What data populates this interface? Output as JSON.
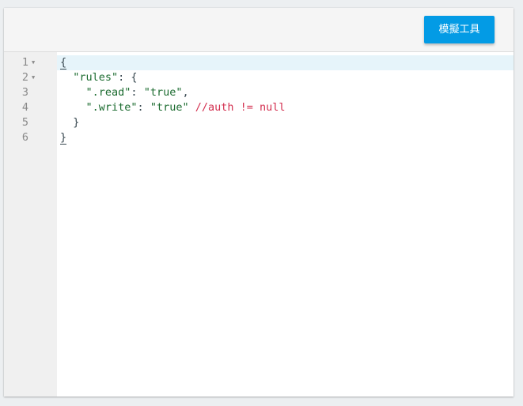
{
  "toolbar": {
    "simulator_button_label": "模擬工具"
  },
  "editor": {
    "lines": [
      {
        "number": "1",
        "foldable": true
      },
      {
        "number": "2",
        "foldable": true
      },
      {
        "number": "3",
        "foldable": false
      },
      {
        "number": "4",
        "foldable": false
      },
      {
        "number": "5",
        "foldable": false
      },
      {
        "number": "6",
        "foldable": false
      }
    ],
    "code": {
      "line1_open_brace": "{",
      "line2_indent": "  ",
      "line2_key": "\"rules\"",
      "line2_rest": ": {",
      "line3_indent": "    ",
      "line3_key": "\".read\"",
      "line3_colon": ": ",
      "line3_value": "\"true\"",
      "line3_comma": ",",
      "line4_indent": "    ",
      "line4_key": "\".write\"",
      "line4_colon": ": ",
      "line4_value": "\"true\"",
      "line4_space": " ",
      "line4_comment": "//auth != null",
      "line5_text": "  }",
      "line6_close_brace": "}"
    },
    "fold_icon_glyph": "▼",
    "active_line": 1
  }
}
